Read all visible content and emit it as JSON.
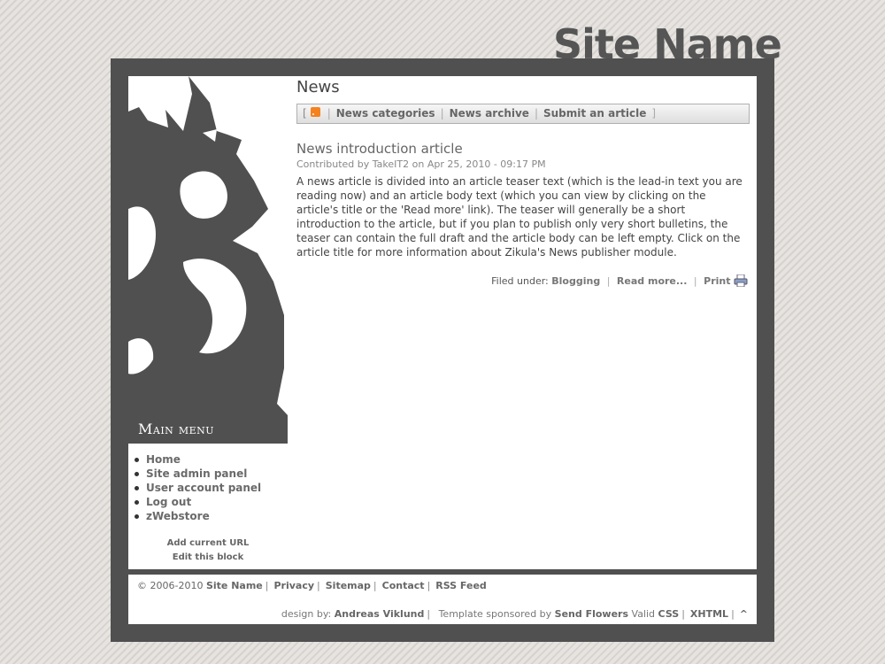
{
  "site": {
    "title": "Site Name"
  },
  "content": {
    "heading": "News",
    "nav": {
      "open_bracket": "[",
      "close_bracket": "]",
      "separator": "|",
      "categories": "News categories",
      "archive": "News archive",
      "submit": "Submit an article"
    },
    "article": {
      "title": "News introduction article",
      "meta": "Contributed by TakeIT2 on Apr 25, 2010 - 09:17 PM",
      "body": "A news article is divided into an article teaser text (which is the lead-in text you are reading now) and an article body text (which you can view by clicking on the article's title or the 'Read more' link). The teaser will generally be a short introduction to the article, but if you plan to publish only very short bulletins, the teaser can contain the full draft and the article body can be left empty. Click on the article title for more information about Zikula's News publisher module.",
      "filed_under": "Filed under:",
      "category": "Blogging",
      "read_more": "Read more...",
      "print": "Print"
    }
  },
  "sidebar": {
    "menu_title": "Main menu",
    "items": [
      {
        "label": "Home"
      },
      {
        "label": "Site admin panel"
      },
      {
        "label": "User account panel"
      },
      {
        "label": "Log out"
      },
      {
        "label": "zWebstore"
      }
    ],
    "add_url": "Add current URL",
    "edit_block": "Edit this block"
  },
  "footer": {
    "copyright": "© 2006-2010",
    "site_name": "Site Name",
    "privacy": "Privacy",
    "sitemap": "Sitemap",
    "contact": "Contact",
    "rss": "RSS Feed",
    "design_by": "design by:",
    "designer": "Andreas Viklund",
    "sponsored": "Template sponsored by",
    "sponsor": "Send Flowers",
    "valid": "Valid",
    "css": "CSS",
    "xhtml": "XHTML",
    "separator": "|",
    "up": "^"
  },
  "colors": {
    "frame": "#505050",
    "background": "#e2dfdc",
    "rss_orange": "#f58220"
  },
  "icons": [
    "dragon-artwork",
    "rss-icon",
    "printer-icon",
    "bullet"
  ]
}
